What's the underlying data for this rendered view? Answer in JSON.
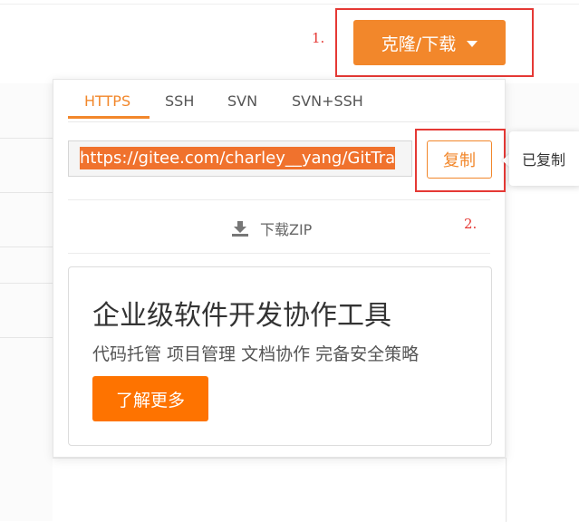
{
  "annotations": {
    "step1": "1.",
    "step2": "2."
  },
  "clone_button": {
    "label": "克隆/下载",
    "icon": "caret-down-icon",
    "color": "#f2872b"
  },
  "dropdown": {
    "tabs": [
      {
        "label": "HTTPS",
        "active": true
      },
      {
        "label": "SSH",
        "active": false
      },
      {
        "label": "SVN",
        "active": false
      },
      {
        "label": "SVN+SSH",
        "active": false
      }
    ],
    "url_field": {
      "value": "https://gitee.com/charley__yang/GitTra"
    },
    "copy_button": {
      "label": "复制"
    },
    "download_zip": {
      "label": "下载ZIP",
      "icon": "download-icon"
    },
    "promo": {
      "title": "企业级软件开发协作工具",
      "subtitle": "代码托管 项目管理 文档协作 完备安全策略",
      "button_label": "了解更多",
      "button_color": "#fe7300"
    }
  },
  "tooltip": {
    "text": "已复制"
  },
  "colors": {
    "accent": "#f2872b",
    "annotation": "#e53935",
    "selection": "#f0722d"
  }
}
